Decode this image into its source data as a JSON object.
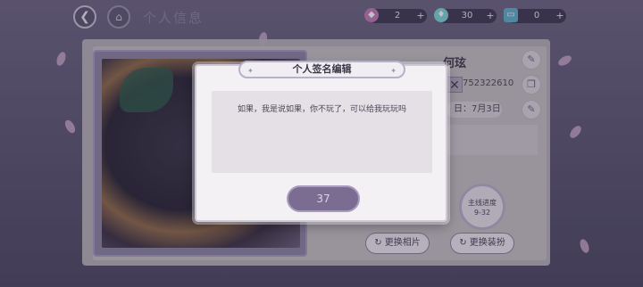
{
  "header": {
    "back_icon": "back-arrow-icon",
    "home_icon": "hall-icon",
    "title": "个人信息"
  },
  "resources": [
    {
      "icon": "gem-icon",
      "value": "2"
    },
    {
      "icon": "diamond-icon",
      "value": "30"
    },
    {
      "icon": "ticket-icon",
      "value": "0"
    }
  ],
  "profile": {
    "name": "何玹",
    "uid": "752322610",
    "birthday": "日：7月3日",
    "progress_label": "主线进度",
    "progress_value": "9-32",
    "change_photo": "更换相片",
    "change_outfit": "更换装扮"
  },
  "dialog": {
    "title": "个人签名编辑",
    "signature": "如果，我是说如果，你不玩了，可以给我玩玩吗",
    "count": "37"
  },
  "colors": {
    "accent": "#7b6d92",
    "dialog_bg": "#f4f1f4"
  }
}
